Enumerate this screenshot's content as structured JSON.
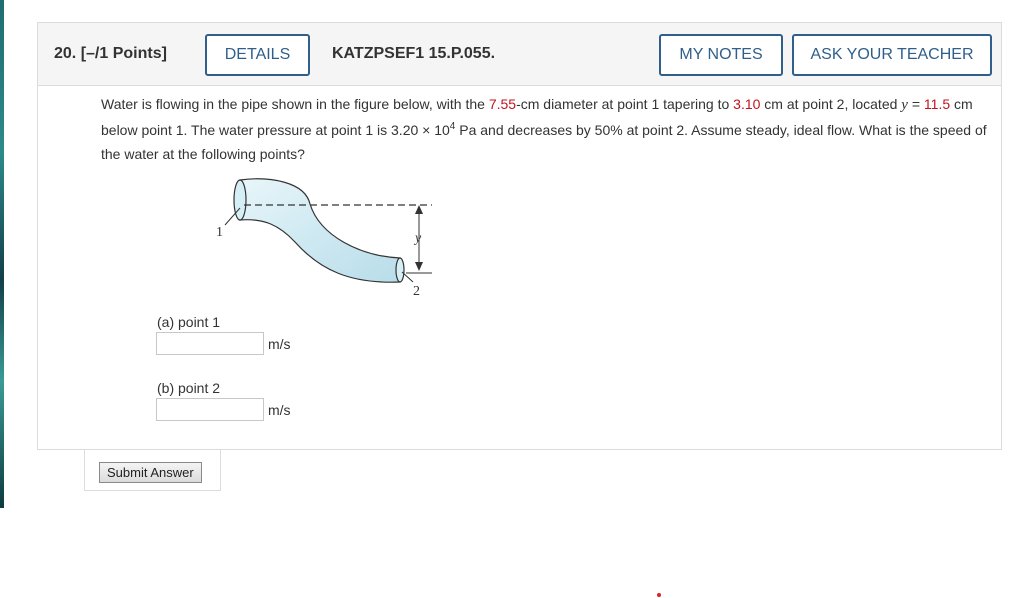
{
  "header": {
    "question_number": "20.",
    "points": "[–/1 Points]",
    "details_label": "DETAILS",
    "problem_code": "KATZPSEF1 15.P.055.",
    "my_notes_label": "MY NOTES",
    "ask_teacher_label": "ASK YOUR TEACHER"
  },
  "question": {
    "t1": "Water is flowing in the pipe shown in the figure below, with the ",
    "d1": "7.55",
    "t2": "-cm diameter at point 1 tapering to ",
    "d2": "3.10",
    "t3": " cm at point 2, located ",
    "y_var": "y",
    "t4": " = ",
    "y_val": "11.5",
    "t5": " cm below point 1. The water pressure at point 1 is 3.20 × 10",
    "exp": "4",
    "t6": " Pa and decreases by 50% at point 2. Assume steady, ideal flow. What is the speed of the water at the following points?"
  },
  "figure": {
    "label_1": "1",
    "label_2": "2",
    "label_y": "y",
    "pipe_color": "#cfe9f2",
    "outline_color": "#333333"
  },
  "parts": [
    {
      "label": "(a) point 1",
      "value": "",
      "unit": "m/s"
    },
    {
      "label": "(b) point 2",
      "value": "",
      "unit": "m/s"
    }
  ],
  "submit_label": "Submit Answer",
  "colors": {
    "accent": "#2f5f8a",
    "given_value": "#c0141e"
  }
}
